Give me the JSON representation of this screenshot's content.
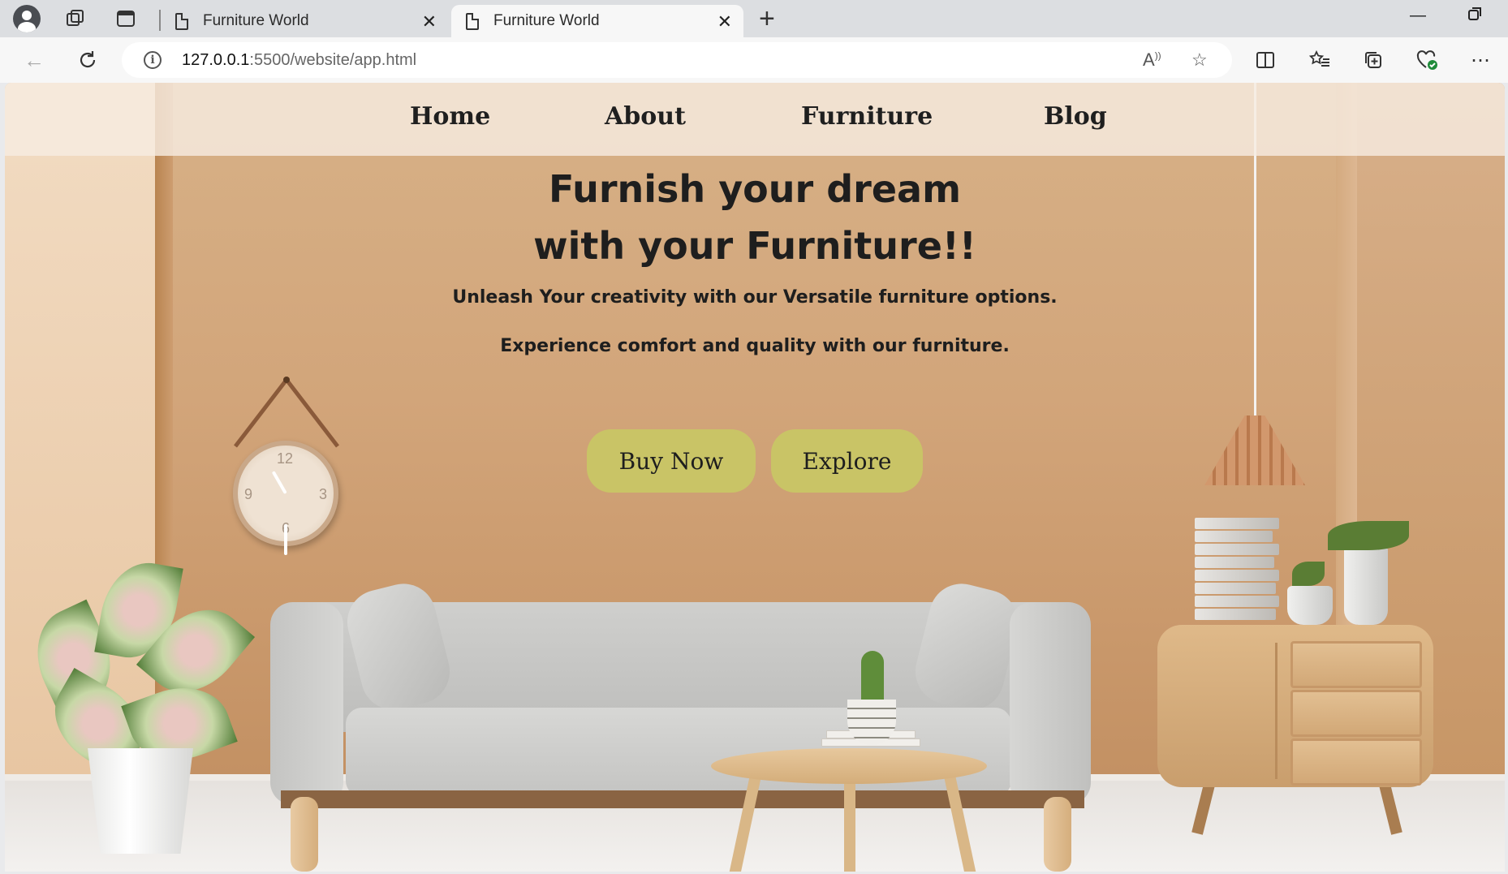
{
  "browser": {
    "tabs": [
      {
        "title": "Furniture World",
        "active": false
      },
      {
        "title": "Furniture World",
        "active": true
      }
    ],
    "address": {
      "host": "127.0.0.1",
      "path": ":5500/website/app.html"
    }
  },
  "site": {
    "nav": [
      "Home",
      "About",
      "Furniture",
      "Blog"
    ],
    "hero": {
      "title_line1": "Furnish your dream",
      "title_line2": "with your Furniture!!",
      "subtitle1": "Unleash Your creativity with our Versatile furniture options.",
      "subtitle2": "Experience comfort and quality with our furniture."
    },
    "buttons": {
      "buy": "Buy Now",
      "explore": "Explore"
    },
    "colors": {
      "button_bg": "#c9c466",
      "header_bg": "#f7ece1",
      "wall": "#d2a57a"
    },
    "clock_numbers": [
      "12",
      "3",
      "9",
      "6"
    ]
  }
}
